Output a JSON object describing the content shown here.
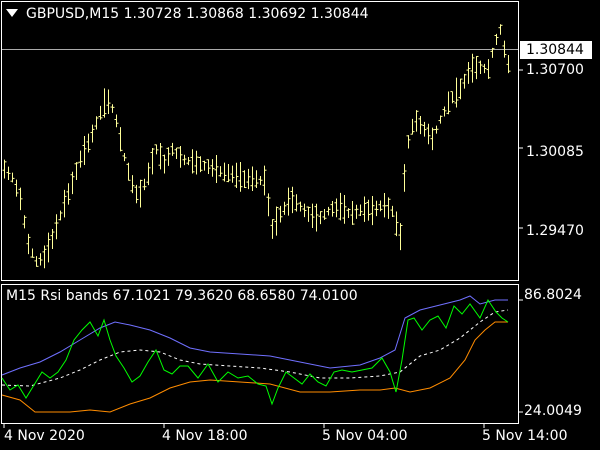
{
  "main_chart": {
    "title": "GBPUSD,M15  1.30728 1.30868 1.30692 1.30844",
    "current_price": "1.30844",
    "price_labels": [
      "1.30700",
      "1.30085",
      "1.29470"
    ]
  },
  "indicator": {
    "title": "M15 Rsi bands 67.1021 79.3620 68.6580 74.0100",
    "scale_labels": [
      "86.8024",
      "24.0049"
    ]
  },
  "time_axis": {
    "labels": [
      "4 Nov 2020",
      "4 Nov 18:00",
      "5 Nov 04:00",
      "5 Nov 14:00"
    ]
  },
  "colors": {
    "background": "#000000",
    "frame": "#ffffff",
    "bars": "#ffff99",
    "rsi": "#00ff00",
    "upper_band": "#7070ff",
    "lower_band": "#ff8c00",
    "middle": "#ffffff"
  },
  "icons": {
    "dropdown": "triangle-down-icon"
  }
}
